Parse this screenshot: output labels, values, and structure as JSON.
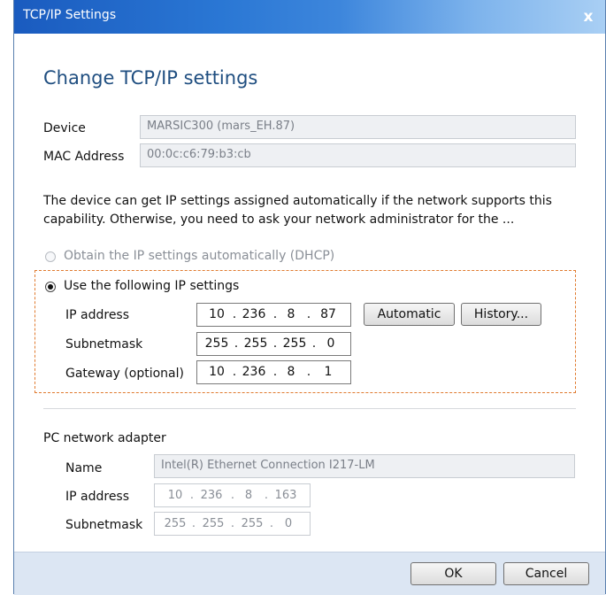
{
  "window": {
    "title": "TCP/IP Settings",
    "close_glyph": "x"
  },
  "heading": "Change TCP/IP settings",
  "device": {
    "label": "Device",
    "value": "MARSIC300 (mars_EH.87)",
    "mac_label": "MAC Address",
    "mac_value": "00:0c:c6:79:b3:cb"
  },
  "description": "The device can get IP settings assigned automatically if the network supports this capability. Otherwise, you need to ask your network administrator for the ...",
  "dhcp": {
    "label": "Obtain the IP settings automatically (DHCP)",
    "selected": false,
    "enabled": false
  },
  "manual": {
    "label": "Use the following IP settings",
    "selected": true,
    "ip_label": "IP address",
    "ip": [
      "10",
      "236",
      "8",
      "87"
    ],
    "subnet_label": "Subnetmask",
    "subnet": [
      "255",
      "255",
      "255",
      "0"
    ],
    "gateway_label": "Gateway (optional)",
    "gateway": [
      "10",
      "236",
      "8",
      "1"
    ],
    "automatic_button": "Automatic",
    "history_button": "History..."
  },
  "adapter": {
    "section_label": "PC network adapter",
    "name_label": "Name",
    "name_value": "Intel(R) Ethernet Connection I217-LM",
    "ip_label": "IP address",
    "ip": [
      "10",
      "236",
      "8",
      "163"
    ],
    "subnet_label": "Subnetmask",
    "subnet": [
      "255",
      "255",
      "255",
      "0"
    ]
  },
  "buttons": {
    "ok": "OK",
    "cancel": "Cancel"
  },
  "colors": {
    "title_bar": "#2a77d4",
    "accent_dash": "#e07a2e",
    "heading": "#1f4e80",
    "footer": "#dce6f3"
  }
}
